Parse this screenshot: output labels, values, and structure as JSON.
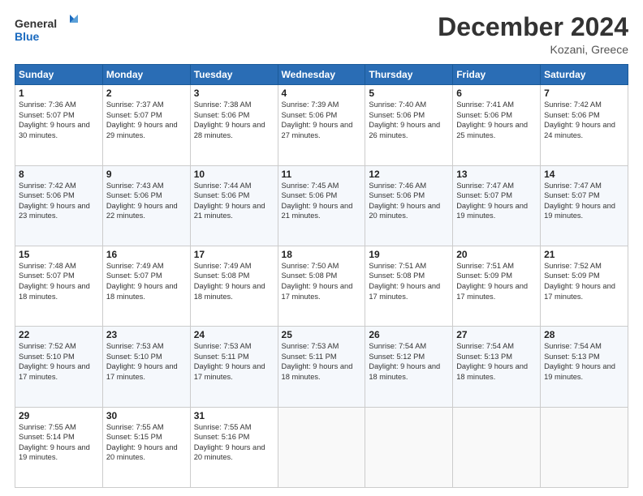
{
  "logo": {
    "general": "General",
    "blue": "Blue"
  },
  "header": {
    "month_year": "December 2024",
    "location": "Kozani, Greece"
  },
  "weekdays": [
    "Sunday",
    "Monday",
    "Tuesday",
    "Wednesday",
    "Thursday",
    "Friday",
    "Saturday"
  ],
  "weeks": [
    [
      {
        "day": "1",
        "sunrise": "7:36 AM",
        "sunset": "5:07 PM",
        "daylight": "9 hours and 30 minutes."
      },
      {
        "day": "2",
        "sunrise": "7:37 AM",
        "sunset": "5:07 PM",
        "daylight": "9 hours and 29 minutes."
      },
      {
        "day": "3",
        "sunrise": "7:38 AM",
        "sunset": "5:06 PM",
        "daylight": "9 hours and 28 minutes."
      },
      {
        "day": "4",
        "sunrise": "7:39 AM",
        "sunset": "5:06 PM",
        "daylight": "9 hours and 27 minutes."
      },
      {
        "day": "5",
        "sunrise": "7:40 AM",
        "sunset": "5:06 PM",
        "daylight": "9 hours and 26 minutes."
      },
      {
        "day": "6",
        "sunrise": "7:41 AM",
        "sunset": "5:06 PM",
        "daylight": "9 hours and 25 minutes."
      },
      {
        "day": "7",
        "sunrise": "7:42 AM",
        "sunset": "5:06 PM",
        "daylight": "9 hours and 24 minutes."
      }
    ],
    [
      {
        "day": "8",
        "sunrise": "7:42 AM",
        "sunset": "5:06 PM",
        "daylight": "9 hours and 23 minutes."
      },
      {
        "day": "9",
        "sunrise": "7:43 AM",
        "sunset": "5:06 PM",
        "daylight": "9 hours and 22 minutes."
      },
      {
        "day": "10",
        "sunrise": "7:44 AM",
        "sunset": "5:06 PM",
        "daylight": "9 hours and 21 minutes."
      },
      {
        "day": "11",
        "sunrise": "7:45 AM",
        "sunset": "5:06 PM",
        "daylight": "9 hours and 21 minutes."
      },
      {
        "day": "12",
        "sunrise": "7:46 AM",
        "sunset": "5:06 PM",
        "daylight": "9 hours and 20 minutes."
      },
      {
        "day": "13",
        "sunrise": "7:47 AM",
        "sunset": "5:07 PM",
        "daylight": "9 hours and 19 minutes."
      },
      {
        "day": "14",
        "sunrise": "7:47 AM",
        "sunset": "5:07 PM",
        "daylight": "9 hours and 19 minutes."
      }
    ],
    [
      {
        "day": "15",
        "sunrise": "7:48 AM",
        "sunset": "5:07 PM",
        "daylight": "9 hours and 18 minutes."
      },
      {
        "day": "16",
        "sunrise": "7:49 AM",
        "sunset": "5:07 PM",
        "daylight": "9 hours and 18 minutes."
      },
      {
        "day": "17",
        "sunrise": "7:49 AM",
        "sunset": "5:08 PM",
        "daylight": "9 hours and 18 minutes."
      },
      {
        "day": "18",
        "sunrise": "7:50 AM",
        "sunset": "5:08 PM",
        "daylight": "9 hours and 17 minutes."
      },
      {
        "day": "19",
        "sunrise": "7:51 AM",
        "sunset": "5:08 PM",
        "daylight": "9 hours and 17 minutes."
      },
      {
        "day": "20",
        "sunrise": "7:51 AM",
        "sunset": "5:09 PM",
        "daylight": "9 hours and 17 minutes."
      },
      {
        "day": "21",
        "sunrise": "7:52 AM",
        "sunset": "5:09 PM",
        "daylight": "9 hours and 17 minutes."
      }
    ],
    [
      {
        "day": "22",
        "sunrise": "7:52 AM",
        "sunset": "5:10 PM",
        "daylight": "9 hours and 17 minutes."
      },
      {
        "day": "23",
        "sunrise": "7:53 AM",
        "sunset": "5:10 PM",
        "daylight": "9 hours and 17 minutes."
      },
      {
        "day": "24",
        "sunrise": "7:53 AM",
        "sunset": "5:11 PM",
        "daylight": "9 hours and 17 minutes."
      },
      {
        "day": "25",
        "sunrise": "7:53 AM",
        "sunset": "5:11 PM",
        "daylight": "9 hours and 18 minutes."
      },
      {
        "day": "26",
        "sunrise": "7:54 AM",
        "sunset": "5:12 PM",
        "daylight": "9 hours and 18 minutes."
      },
      {
        "day": "27",
        "sunrise": "7:54 AM",
        "sunset": "5:13 PM",
        "daylight": "9 hours and 18 minutes."
      },
      {
        "day": "28",
        "sunrise": "7:54 AM",
        "sunset": "5:13 PM",
        "daylight": "9 hours and 19 minutes."
      }
    ],
    [
      {
        "day": "29",
        "sunrise": "7:55 AM",
        "sunset": "5:14 PM",
        "daylight": "9 hours and 19 minutes."
      },
      {
        "day": "30",
        "sunrise": "7:55 AM",
        "sunset": "5:15 PM",
        "daylight": "9 hours and 20 minutes."
      },
      {
        "day": "31",
        "sunrise": "7:55 AM",
        "sunset": "5:16 PM",
        "daylight": "9 hours and 20 minutes."
      },
      null,
      null,
      null,
      null
    ]
  ],
  "labels": {
    "sunrise": "Sunrise:",
    "sunset": "Sunset:",
    "daylight": "Daylight:"
  }
}
